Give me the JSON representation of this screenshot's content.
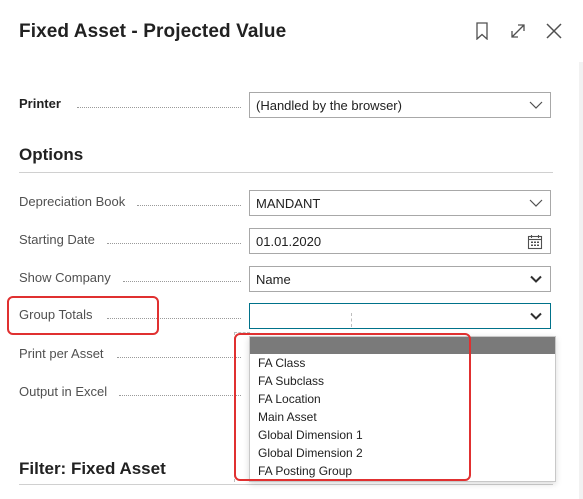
{
  "dialog": {
    "title": "Fixed Asset - Projected Value",
    "icons": [
      "bookmark-icon",
      "expand-icon",
      "close-icon"
    ]
  },
  "printer": {
    "label": "Printer",
    "value": "(Handled by the browser)"
  },
  "options": {
    "heading": "Options",
    "depreciation_book": {
      "label": "Depreciation Book",
      "value": "MANDANT"
    },
    "starting_date": {
      "label": "Starting Date",
      "value": "01.01.2020"
    },
    "show_company": {
      "label": "Show Company",
      "value": "Name"
    },
    "group_totals": {
      "label": "Group Totals",
      "value": ""
    },
    "print_per_asset": {
      "label": "Print per Asset"
    },
    "output_in_excel": {
      "label": "Output in Excel"
    }
  },
  "group_totals_options": [
    "",
    "FA Class",
    "FA Subclass",
    "FA Location",
    "Main Asset",
    "Global Dimension 1",
    "Global Dimension 2",
    "FA Posting Group"
  ],
  "filter": {
    "heading": "Filter: Fixed Asset"
  },
  "colors": {
    "focus_border": "#00728a",
    "highlight_red": "#e03030",
    "selected_blank": "#7a7a7a"
  }
}
